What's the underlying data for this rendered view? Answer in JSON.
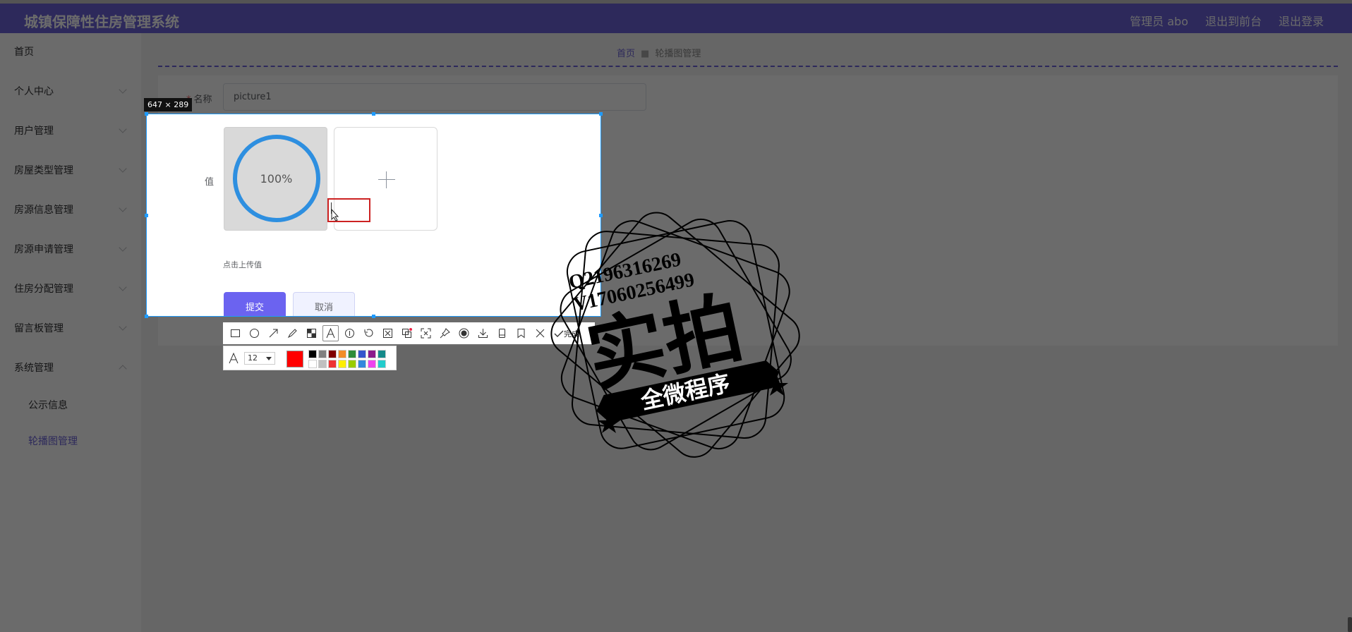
{
  "header": {
    "title": "城镇保障性住房管理系统",
    "nav": [
      "管理员 abo",
      "退出到前台",
      "退出登录"
    ]
  },
  "sidebar": {
    "items": [
      {
        "label": "首页"
      },
      {
        "label": "个人中心"
      },
      {
        "label": "用户管理"
      },
      {
        "label": "房屋类型管理"
      },
      {
        "label": "房源信息管理"
      },
      {
        "label": "房源申请管理"
      },
      {
        "label": "住房分配管理"
      },
      {
        "label": "留言板管理"
      },
      {
        "label": "系统管理"
      },
      {
        "label": "公示信息"
      },
      {
        "label": "轮播图管理"
      }
    ]
  },
  "breadcrumb": {
    "home": "首页",
    "current": "轮播图管理"
  },
  "form": {
    "name_label": "名称",
    "name_required": "*",
    "name_value": "picture1",
    "value_label": "值",
    "upload_progress": "100%",
    "upload_hint": "点击上传值",
    "submit_label": "提交",
    "cancel_label": "取消"
  },
  "screenshot_tool": {
    "size_label": "647 × 289",
    "done_label": "完成",
    "font_size": "12",
    "current_color": "#ff0000",
    "tools": [
      "rectangle-icon",
      "ellipse-icon",
      "arrow-icon",
      "pencil-icon",
      "mosaic-icon",
      "text-icon",
      "serial-number-icon",
      "undo-icon",
      "scissors-icon",
      "translate-icon",
      "ocr-icon",
      "pin-icon",
      "record-icon",
      "download-icon",
      "long-screenshot-icon",
      "bookmark-icon",
      "close-icon",
      "check-icon"
    ],
    "palette": [
      "#000000",
      "#808080",
      "#800000",
      "#f28c28",
      "#2e8b3a",
      "#3355cc",
      "#8b1a8b",
      "#148a8a",
      "#ffffff",
      "#c0c0c0",
      "#ee3333",
      "#ffee00",
      "#99cc00",
      "#3388dd",
      "#ee44ee",
      "#22cccc"
    ]
  },
  "watermark": {
    "line1": "Q2196316269",
    "line2": "V17060256499",
    "big_text": "实拍",
    "ribbon_text": "全微程序"
  }
}
